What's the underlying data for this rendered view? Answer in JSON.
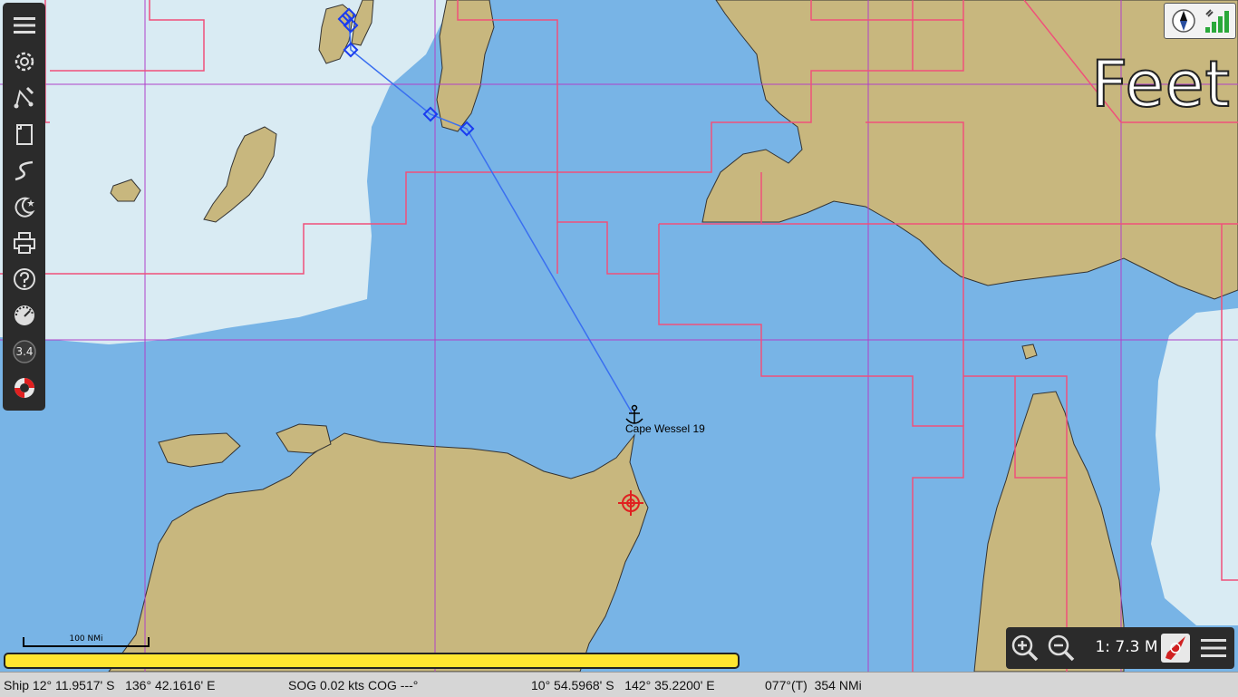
{
  "map": {
    "place_label": "Cape Wessel 19",
    "depth_units": "Feet",
    "colors": {
      "sea": "#78b4e6",
      "shallow": "#d9ebf3",
      "land": "#c8b77e",
      "chart_border": "#f0507a",
      "grid": "#b040c8",
      "route": "#3a6ff0",
      "waypoint": "#1a3cf0",
      "target": "#e02020"
    }
  },
  "toolbar": {
    "items": [
      {
        "name": "menu-icon"
      },
      {
        "name": "gear-icon"
      },
      {
        "name": "route-tool-icon"
      },
      {
        "name": "documents-icon"
      },
      {
        "name": "track-icon"
      },
      {
        "name": "night-mode-icon"
      },
      {
        "name": "print-icon"
      },
      {
        "name": "help-icon"
      },
      {
        "name": "dashboard-icon"
      },
      {
        "name": "version-icon",
        "label": "3.4"
      },
      {
        "name": "lifebuoy-icon"
      }
    ]
  },
  "scale_bar": {
    "label": "100 NMi"
  },
  "zoom": {
    "scale": "1: 7.3 M"
  },
  "progress": {
    "fraction": 1.0
  },
  "status": {
    "ship": "Ship 12° 11.9517' S   136° 42.1616' E",
    "sog": "SOG 0.02 kts",
    "cog": "COG ---°",
    "cursor": "10° 54.5968' S   142° 35.2200' E",
    "bearing": "077°(T)  354 NMi"
  }
}
